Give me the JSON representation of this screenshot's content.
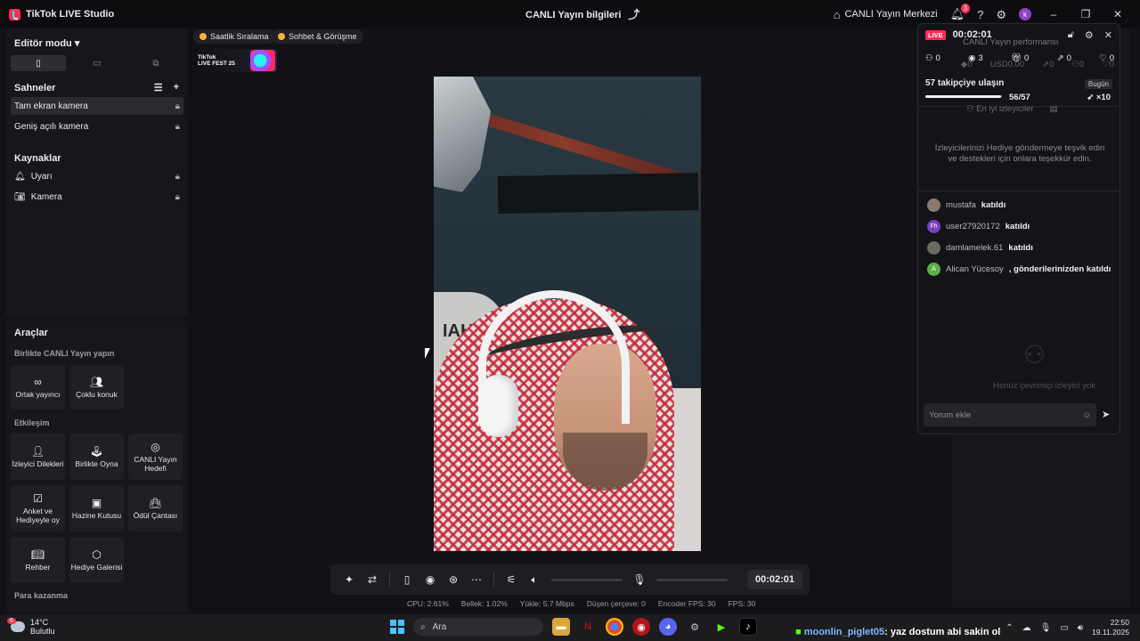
{
  "app": {
    "title": "TikTok LIVE Studio",
    "center_title": "CANLI Yayın bilgileri",
    "live_center": "CANLI Yayın Merkezi",
    "notification_count": "3",
    "avatar_letter": "k"
  },
  "left": {
    "editor_mode": "Editör modu",
    "scenes_title": "Sahneler",
    "scenes": [
      "Tam ekran kamera",
      "Geniş açılı kamera"
    ],
    "sources_title": "Kaynaklar",
    "sources": [
      "Uyarı",
      "Kamera"
    ]
  },
  "tools": {
    "title": "Araçlar",
    "group1": "Birlikte CANLI Yayın yapın",
    "group2": "Etkileşim",
    "group3": "Para kazanma",
    "items": {
      "cohost": "Ortak yayıncı",
      "multiguest": "Çoklu konuk",
      "viewer_requests": "İzleyici Dilekleri",
      "play_together": "Birlikte Oyna",
      "live_goal": "CANLI Yayın Hedefi",
      "poll": "Anket ve Hediyeyle oy",
      "treasure": "Hazine Kutusu",
      "reward_bag": "Ödül Çantası",
      "guide": "Rehber",
      "gift_gallery": "Hediye Galerisi"
    }
  },
  "chips": {
    "hourly": "Saatlik Sıralama",
    "chat": "Sohbet & Görüşme",
    "livefest_line1": "TikTok",
    "livefest_line2": "LIVE FEST 25"
  },
  "preview": {
    "cap_text": "IAH"
  },
  "controls": {
    "timer": "00:02:01"
  },
  "stats": {
    "cpu": "CPU:  2.61%",
    "memory": "Bellek:  1.02%",
    "upload": "Yükle:  5.7 Mbps",
    "dropped": "Düşen çerçeve:  0",
    "encoder": "Encoder FPS:  30",
    "fps": "FPS:  30"
  },
  "live": {
    "tag": "LIVE",
    "time": "00:02:01",
    "subtitle": "CANLI Yayın performansı",
    "metrics": {
      "viewers": "0",
      "views": "3",
      "gifts": "0",
      "shares": "0",
      "likes": "0"
    },
    "ghost": {
      "diamonds": "0",
      "usd": "USD0.00",
      "a": "0",
      "b": "0",
      "c": "0"
    },
    "goal_title": "57 takipçiye ulaşın",
    "today": "Bugün",
    "progress_count": "56/57",
    "progress_ratio": 0.982,
    "multiplier": "×10",
    "best_viewers": "En iyi izleyiciler",
    "promo": "İzleyicilerinizi Hediye göndermeye teşvik edin ve destekleri için onlara teşekkür edin.",
    "feed": [
      {
        "name": "mustafa",
        "action": "katıldı",
        "avatar": "",
        "color": "#8a7a6e"
      },
      {
        "name": "user27920172",
        "action": "katıldı",
        "avatar": "Fh",
        "color": "#7a3ec2"
      },
      {
        "name": "damlamelek.61",
        "action": "katıldı",
        "avatar": "",
        "color": "#6a6a60"
      },
      {
        "name": "Alican Yücesoy",
        "action": ", gönderilerinizden katıldı",
        "avatar": "A",
        "color": "#5fae4a"
      }
    ],
    "empty": "Henüz çevrimiçi izleyici yok",
    "comment_placeholder": "Yorum ekle"
  },
  "taskbar": {
    "temp": "14°C",
    "weather": "Bulutlu",
    "weather_badge": "6",
    "search": "Ara",
    "ticker_user": "moonlin_piglet05",
    "ticker_text": ": yaz dostum abi sakin ol",
    "time": "22:50",
    "date": "19.11.2025"
  }
}
